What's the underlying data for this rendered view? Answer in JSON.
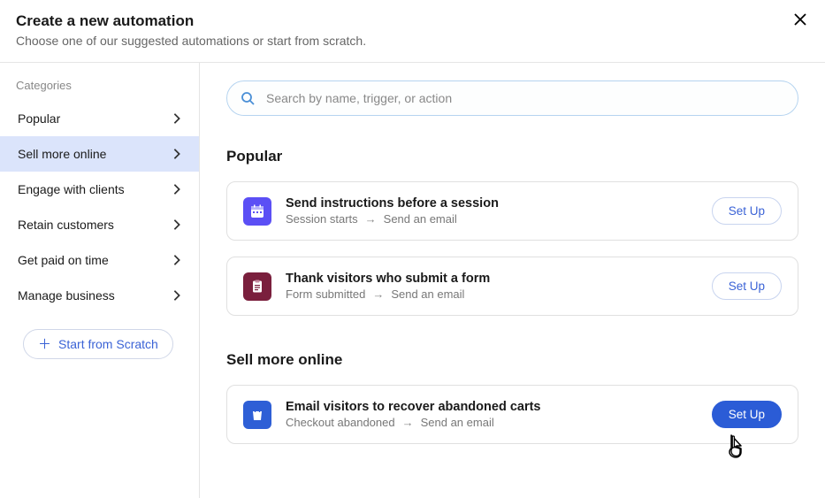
{
  "header": {
    "title": "Create a new automation",
    "subtitle": "Choose one of our suggested automations or start from scratch."
  },
  "sidebar": {
    "label": "Categories",
    "items": [
      {
        "label": "Popular",
        "active": false
      },
      {
        "label": "Sell more online",
        "active": true
      },
      {
        "label": "Engage with clients",
        "active": false
      },
      {
        "label": "Retain customers",
        "active": false
      },
      {
        "label": "Get paid on time",
        "active": false
      },
      {
        "label": "Manage business",
        "active": false
      }
    ],
    "scratch_label": "Start from Scratch"
  },
  "search": {
    "placeholder": "Search by name, trigger, or action"
  },
  "sections": [
    {
      "title": "Popular",
      "cards": [
        {
          "icon": "calendar-icon",
          "icon_color": "purple",
          "title": "Send instructions before a session",
          "trigger": "Session starts",
          "action": "Send an email",
          "setup_label": "Set Up",
          "primary": false
        },
        {
          "icon": "clipboard-icon",
          "icon_color": "maroon",
          "title": "Thank visitors who submit a form",
          "trigger": "Form submitted",
          "action": "Send an email",
          "setup_label": "Set Up",
          "primary": false
        }
      ]
    },
    {
      "title": "Sell more online",
      "cards": [
        {
          "icon": "shopping-bag-icon",
          "icon_color": "blue",
          "title": "Email visitors to recover abandoned carts",
          "trigger": "Checkout abandoned",
          "action": "Send an email",
          "setup_label": "Set Up",
          "primary": true
        }
      ]
    }
  ]
}
